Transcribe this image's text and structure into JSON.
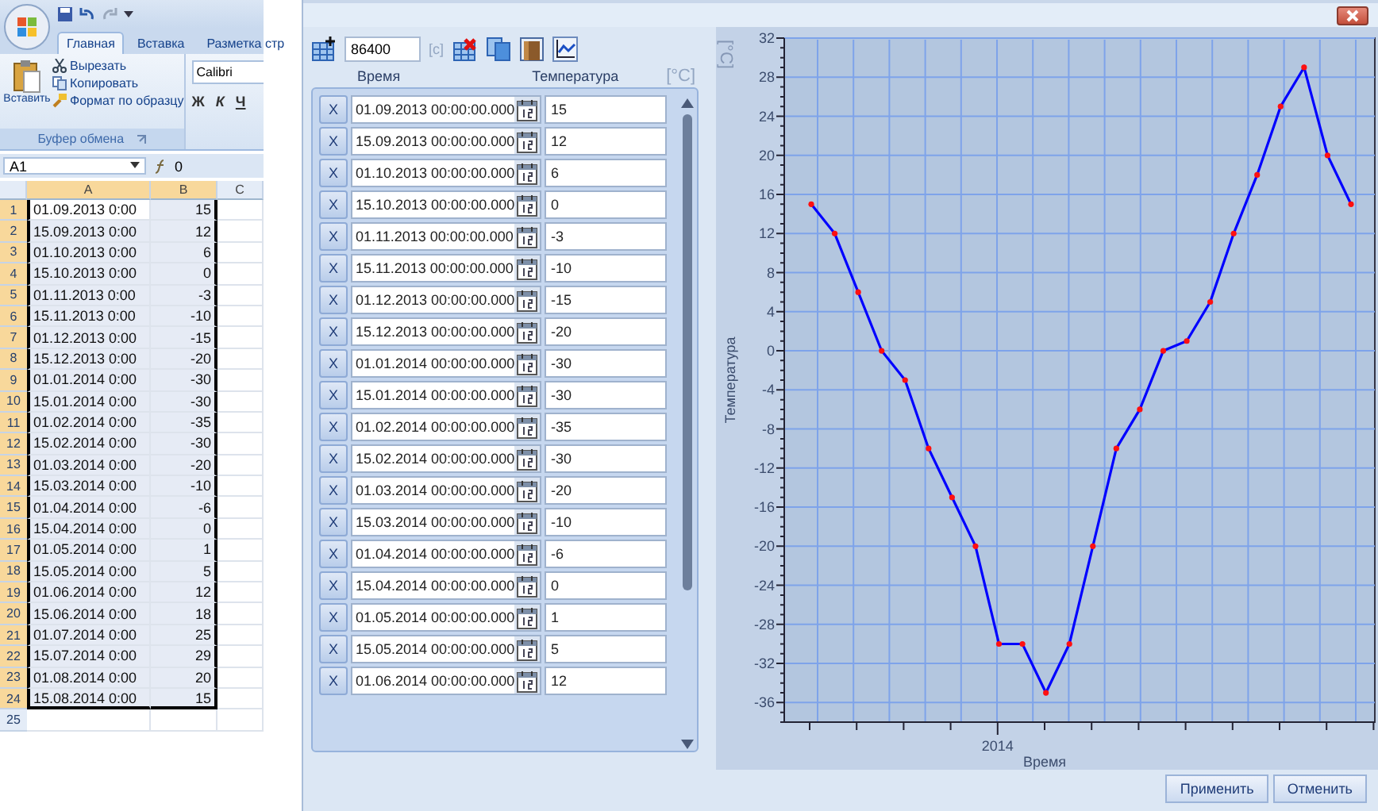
{
  "spreadsheet": {
    "tabs": [
      {
        "label": "Главная",
        "selected": true
      },
      {
        "label": "Вставка",
        "selected": false
      },
      {
        "label": "Разметка стр",
        "selected": false
      }
    ],
    "clipboard": {
      "paste": "Вставить",
      "cut": "Вырезать",
      "copy": "Копировать",
      "format_painter": "Формат по образцу",
      "group_label": "Буфер обмена"
    },
    "font": {
      "name": "Calibri",
      "bold": "Ж",
      "italic": "К",
      "underline": "Ч"
    },
    "name_box": "A1",
    "formula": "0",
    "columns": [
      {
        "label": "A",
        "selected": true
      },
      {
        "label": "B",
        "selected": true
      },
      {
        "label": "C",
        "selected": false
      }
    ],
    "rows": [
      {
        "number": "1",
        "a": "01.09.2013 0:00",
        "b": "15",
        "selected": true
      },
      {
        "number": "2",
        "a": "15.09.2013 0:00",
        "b": "12",
        "selected": true
      },
      {
        "number": "3",
        "a": "01.10.2013 0:00",
        "b": "6",
        "selected": true
      },
      {
        "number": "4",
        "a": "15.10.2013 0:00",
        "b": "0",
        "selected": true
      },
      {
        "number": "5",
        "a": "01.11.2013 0:00",
        "b": "-3",
        "selected": true
      },
      {
        "number": "6",
        "a": "15.11.2013 0:00",
        "b": "-10",
        "selected": true
      },
      {
        "number": "7",
        "a": "01.12.2013 0:00",
        "b": "-15",
        "selected": true
      },
      {
        "number": "8",
        "a": "15.12.2013 0:00",
        "b": "-20",
        "selected": true
      },
      {
        "number": "9",
        "a": "01.01.2014 0:00",
        "b": "-30",
        "selected": true
      },
      {
        "number": "10",
        "a": "15.01.2014 0:00",
        "b": "-30",
        "selected": true
      },
      {
        "number": "11",
        "a": "01.02.2014 0:00",
        "b": "-35",
        "selected": true
      },
      {
        "number": "12",
        "a": "15.02.2014 0:00",
        "b": "-30",
        "selected": true
      },
      {
        "number": "13",
        "a": "01.03.2014 0:00",
        "b": "-20",
        "selected": true
      },
      {
        "number": "14",
        "a": "15.03.2014 0:00",
        "b": "-10",
        "selected": true
      },
      {
        "number": "15",
        "a": "01.04.2014 0:00",
        "b": "-6",
        "selected": true
      },
      {
        "number": "16",
        "a": "15.04.2014 0:00",
        "b": "0",
        "selected": true
      },
      {
        "number": "17",
        "a": "01.05.2014 0:00",
        "b": "1",
        "selected": true
      },
      {
        "number": "18",
        "a": "15.05.2014 0:00",
        "b": "5",
        "selected": true
      },
      {
        "number": "19",
        "a": "01.06.2014 0:00",
        "b": "12",
        "selected": true
      },
      {
        "number": "20",
        "a": "15.06.2014 0:00",
        "b": "18",
        "selected": true
      },
      {
        "number": "21",
        "a": "01.07.2014 0:00",
        "b": "25",
        "selected": true
      },
      {
        "number": "22",
        "a": "15.07.2014 0:00",
        "b": "29",
        "selected": true
      },
      {
        "number": "23",
        "a": "01.08.2014 0:00",
        "b": "20",
        "selected": true
      },
      {
        "number": "24",
        "a": "15.08.2014 0:00",
        "b": "15",
        "selected": true
      },
      {
        "number": "25",
        "selected": false
      }
    ]
  },
  "editor": {
    "interval": "86400",
    "interval_unit": "[c]",
    "columns": {
      "time": "Время",
      "temperature": "Температура",
      "unit": "[°C]"
    },
    "rows": [
      {
        "delete": "X",
        "time": "01.09.2013 00:00:00.000",
        "value": "15"
      },
      {
        "delete": "X",
        "time": "15.09.2013 00:00:00.000",
        "value": "12"
      },
      {
        "delete": "X",
        "time": "01.10.2013 00:00:00.000",
        "value": "6"
      },
      {
        "delete": "X",
        "time": "15.10.2013 00:00:00.000",
        "value": "0"
      },
      {
        "delete": "X",
        "time": "01.11.2013 00:00:00.000",
        "value": "-3"
      },
      {
        "delete": "X",
        "time": "15.11.2013 00:00:00.000",
        "value": "-10"
      },
      {
        "delete": "X",
        "time": "01.12.2013 00:00:00.000",
        "value": "-15"
      },
      {
        "delete": "X",
        "time": "15.12.2013 00:00:00.000",
        "value": "-20"
      },
      {
        "delete": "X",
        "time": "01.01.2014 00:00:00.000",
        "value": "-30"
      },
      {
        "delete": "X",
        "time": "15.01.2014 00:00:00.000",
        "value": "-30"
      },
      {
        "delete": "X",
        "time": "01.02.2014 00:00:00.000",
        "value": "-35"
      },
      {
        "delete": "X",
        "time": "15.02.2014 00:00:00.000",
        "value": "-30"
      },
      {
        "delete": "X",
        "time": "01.03.2014 00:00:00.000",
        "value": "-20"
      },
      {
        "delete": "X",
        "time": "15.03.2014 00:00:00.000",
        "value": "-10"
      },
      {
        "delete": "X",
        "time": "01.04.2014 00:00:00.000",
        "value": "-6"
      },
      {
        "delete": "X",
        "time": "15.04.2014 00:00:00.000",
        "value": "0"
      },
      {
        "delete": "X",
        "time": "01.05.2014 00:00:00.000",
        "value": "1"
      },
      {
        "delete": "X",
        "time": "15.05.2014 00:00:00.000",
        "value": "5"
      },
      {
        "delete": "X",
        "time": "01.06.2014 00:00:00.000",
        "value": "12"
      }
    ],
    "chart": {
      "unit_label": "[°C]",
      "year_label": "2014",
      "chart_data": {
        "type": "line",
        "xlabel": "Время",
        "ylabel": "Температура",
        "grid": true,
        "series": [
          {
            "color": "#0000ff",
            "marker": "circle",
            "values": [
              15,
              12,
              6,
              0,
              -3,
              -10,
              -15,
              -20,
              -30,
              -30,
              -35,
              -30,
              -20,
              -10,
              -6,
              0,
              1,
              5,
              12,
              18,
              25,
              29,
              20,
              15
            ]
          }
        ],
        "ylim": [
          -38,
          32
        ],
        "yticks": [
          -36,
          -32,
          -28,
          -24,
          -20,
          -16,
          -12,
          -8,
          -4,
          0,
          4,
          8,
          12,
          16,
          20,
          24,
          28,
          32
        ]
      }
    },
    "buttons": [
      "Применить",
      "Отменить"
    ]
  }
}
